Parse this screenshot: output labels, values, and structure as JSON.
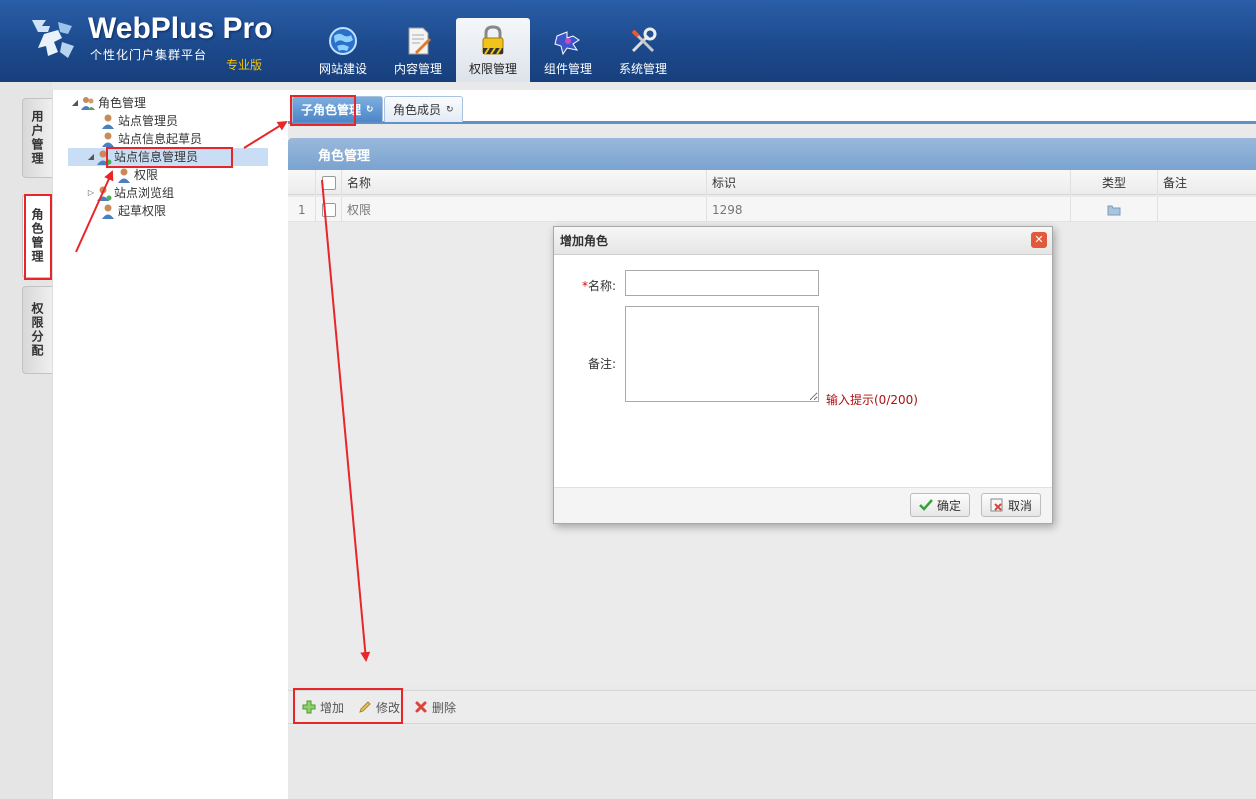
{
  "header": {
    "brand": "WebPlus Pro",
    "subtitle": "个性化门户集群平台",
    "edition": "专业版",
    "nav": [
      {
        "label": "网站建设",
        "icon": "globe-icon"
      },
      {
        "label": "内容管理",
        "icon": "document-edit-icon"
      },
      {
        "label": "权限管理",
        "icon": "lock-icon",
        "active": true
      },
      {
        "label": "组件管理",
        "icon": "puzzle-icon"
      },
      {
        "label": "系统管理",
        "icon": "tools-icon"
      }
    ]
  },
  "side_tabs": [
    {
      "label": "用户管理"
    },
    {
      "label": "角色管理",
      "active": true
    },
    {
      "label": "权限分配"
    }
  ],
  "tree": {
    "root": "角色管理",
    "items": [
      "站点管理员",
      "站点信息起草员",
      "站点信息管理员",
      "权限",
      "站点浏览组",
      "起草权限"
    ]
  },
  "tabs": [
    {
      "label": "子角色管理",
      "active": true
    },
    {
      "label": "角色成员"
    }
  ],
  "panel": {
    "title": "角色管理"
  },
  "grid": {
    "columns": [
      "名称",
      "标识",
      "类型",
      "备注"
    ],
    "rows": [
      {
        "index": "1",
        "name": "权限",
        "id": "1298",
        "type_icon": "folder-icon",
        "remark": ""
      }
    ]
  },
  "toolbar": {
    "add": "增加",
    "edit": "修改",
    "delete": "删除"
  },
  "dialog": {
    "title": "增加角色",
    "name_label": "名称:",
    "required_mark": "*",
    "name_value": "",
    "remark_label": "备注:",
    "remark_value": "",
    "hint": "输入提示(0/200)",
    "ok": "确定",
    "cancel": "取消"
  },
  "colors": {
    "header": "#1d4a8d",
    "accent": "#5f92c9",
    "highlight": "#e8262a"
  }
}
